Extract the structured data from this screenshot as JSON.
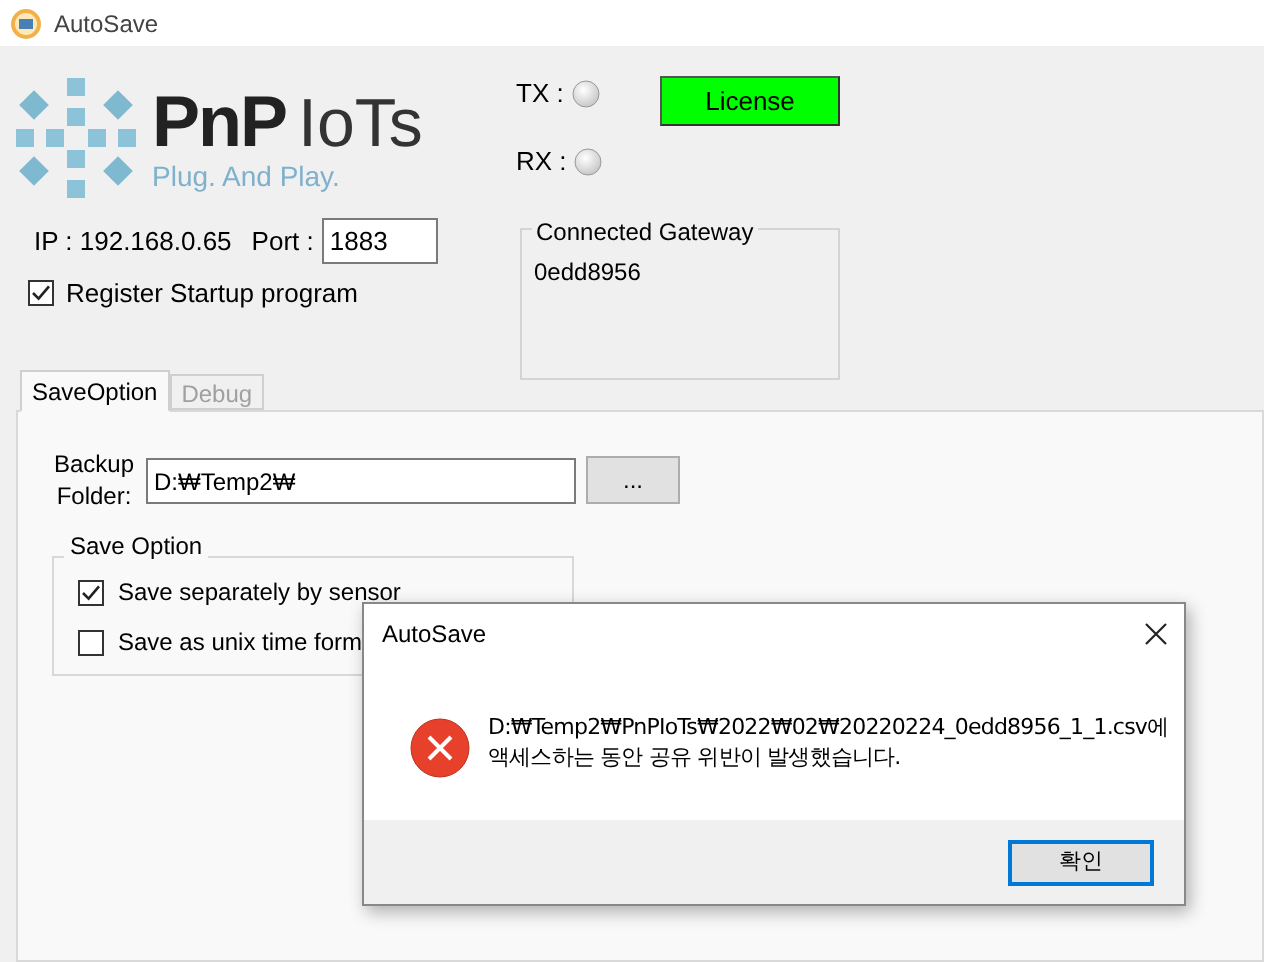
{
  "window": {
    "title": "AutoSave"
  },
  "logo": {
    "brand_bold": "PnP",
    "brand_light": "IoTs",
    "tagline": "Plug. And Play."
  },
  "indicators": [
    {
      "label": "TX :",
      "on": false
    },
    {
      "label": "RX :",
      "on": false
    }
  ],
  "license_button": {
    "label": "License"
  },
  "connection": {
    "ip_label": "IP : 192.168.0.65",
    "port_label": "Port :",
    "port_value": "1883"
  },
  "register_startup": {
    "label": "Register Startup program",
    "checked": true
  },
  "gateway_group": {
    "title": "Connected Gateway",
    "items": [
      "0edd8956"
    ]
  },
  "tabs": [
    {
      "label": "SaveOption",
      "selected": true,
      "disabled": false
    },
    {
      "label": "Debug",
      "selected": false,
      "disabled": true
    }
  ],
  "backup_folder": {
    "label": "Backup\nFolder:",
    "value": "D:₩Temp2₩",
    "browse_label": "..."
  },
  "save_option_group": {
    "title": "Save Option",
    "options": [
      {
        "label": "Save separately by sensor",
        "checked": true
      },
      {
        "label": "Save as unix time form",
        "checked": false
      }
    ]
  },
  "dialog": {
    "title": "AutoSave",
    "kind": "error",
    "message": "D:₩Temp2₩PnPIoTs₩2022₩02₩20220224_0edd8956_1_1.csv에\n액세스하는 동안 공유 위반이 발생했습니다.",
    "buttons": [
      {
        "label": "확인",
        "default": true
      }
    ]
  }
}
